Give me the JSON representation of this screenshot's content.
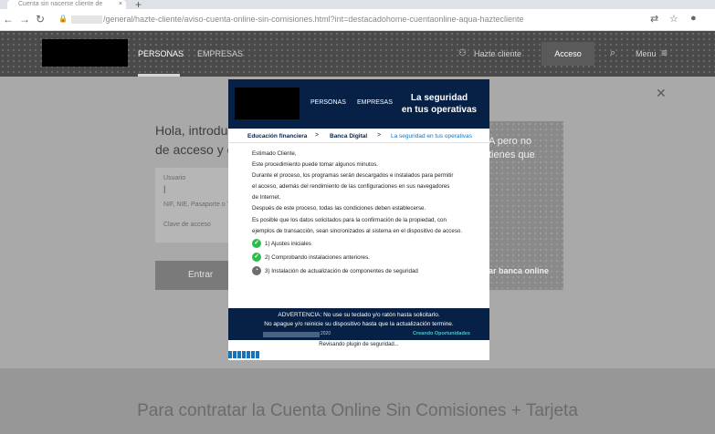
{
  "browser": {
    "tab_title": "Cuenta sin nacerse cliente de",
    "tab_close": "×",
    "new_tab": "+",
    "url": "/general/hazte-cliente/aviso-cuenta-online-sin-comisiones.html?int=destacadohome-cuentaonline-aqua-haztecliente",
    "icons": [
      "back-icon",
      "forward-icon",
      "reload-icon",
      "lock-icon",
      "translate-icon",
      "star-icon",
      "profile-icon"
    ]
  },
  "site": {
    "nav": {
      "personas": "PERSONAS",
      "empresas": "EMPRESAS",
      "hazte_cliente": "Hazte cliente",
      "acceso": "Acceso",
      "menu": "Menu"
    },
    "login": {
      "heading_line1": "Hola, introduc",
      "heading_line2": "de acceso y e",
      "usuario_label": "Usuario",
      "nif_hint": "NIF, NIE, Pasaporte o T",
      "clave_label": "Clave de acceso",
      "entrar": "Entrar"
    },
    "promo": {
      "line1": "A pero no",
      "line2": "tienes que",
      "cta": "ar banca online"
    },
    "contratar": "Para contratar la Cuenta Online Sin Comisiones + Tarjeta"
  },
  "popup": {
    "nav_personas": "PERSONAS",
    "nav_empresas": "EMPRESAS",
    "title_line1": "La seguridad",
    "title_line2": "en tus operativas",
    "breadcrumb": [
      "Educación financiera",
      "Banca Digital",
      "La seguridad en tus operativas"
    ],
    "breadcrumb_sep": ">",
    "body": [
      "Estimado Cliente,",
      "Este procedimiento puede tomar algunos minutos.",
      "Durante el proceso, los programas serán descargados e instalados para permitir",
      "el acceso, además del rendimiento de las configuraciones en sus navegadores",
      "de Internet.",
      "Después de este proceso, todas las condiciones deben establecerse.",
      "Es posible que los datos solicitados para la confirmación de la propiedad, con",
      "ejemplos de transacción, sean sincronizados al sistema en el dispositivo de acceso."
    ],
    "steps": [
      {
        "label": "1) Ajustes iniciales",
        "status": "done"
      },
      {
        "label": "2) Comprobando instalaciones anteriores.",
        "status": "done"
      },
      {
        "label": "3) Instalación de actualización de componentes de seguridad",
        "status": "pending"
      }
    ],
    "warning_line1": "ADVERTENCIA: No use su teclado y/o ratón hasta solicitarlo.",
    "warning_line2": "No apague y/o reinicie su dispositivo hasta que la actualización termine.",
    "footer_year": "2020",
    "footer_link": "Creando Oportunidades",
    "status_text": "Revisando plugin de seguridad...",
    "progress": 0.12,
    "colors": {
      "navy": "#072146",
      "blue": "#1973b8",
      "green": "#2dbb4c",
      "aqua": "#49c5d0"
    }
  }
}
